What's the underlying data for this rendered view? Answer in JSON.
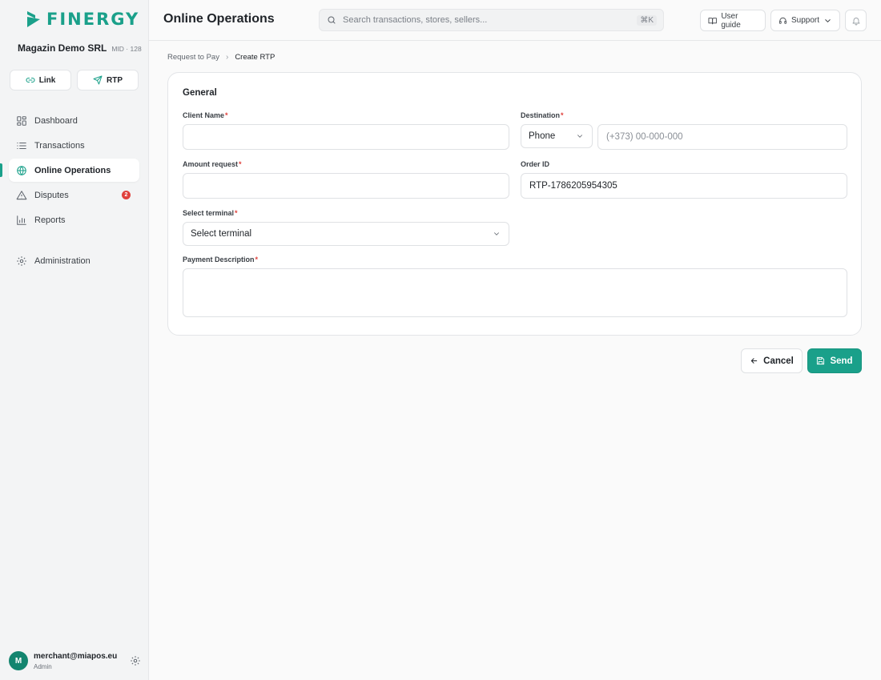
{
  "brand": {
    "name": "FINERGY",
    "accent_color": "#1aa08a"
  },
  "merchant": {
    "name": "Magazin Demo SRL",
    "mid": "MID · 128"
  },
  "quick_actions": [
    {
      "label": "Link",
      "icon": "link-icon"
    },
    {
      "label": "RTP",
      "icon": "send-icon"
    }
  ],
  "sidebar": {
    "items": [
      {
        "label": "Dashboard",
        "icon": "dashboard-icon"
      },
      {
        "label": "Transactions",
        "icon": "list-icon"
      },
      {
        "label": "Online Operations",
        "icon": "globe-icon",
        "active": true
      },
      {
        "label": "Disputes",
        "icon": "warning-icon",
        "badge": "2"
      },
      {
        "label": "Reports",
        "icon": "bar-chart-icon"
      },
      {
        "label": "Administration",
        "icon": "gear-icon"
      }
    ]
  },
  "user": {
    "initial": "M",
    "email": "merchant@miapos.eu",
    "role": "Admin"
  },
  "header": {
    "title": "Online Operations",
    "search_placeholder": "Search transactions, stores, sellers...",
    "search_shortcut": "⌘K",
    "user_guide_label": "User guide",
    "support_label": "Support"
  },
  "breadcrumb": {
    "parent": "Request to Pay",
    "separator": "›",
    "current": "Create RTP"
  },
  "form": {
    "section_title": "General",
    "required_mark": "*",
    "client_name": {
      "label": "Client Name",
      "value": ""
    },
    "destination": {
      "label": "Destination",
      "type_value": "Phone",
      "placeholder": "(+373) 00-000-000"
    },
    "amount": {
      "label": "Amount request",
      "value": ""
    },
    "order_id": {
      "label": "Order ID",
      "value": "RTP-1786205954305"
    },
    "terminal": {
      "label": "Select terminal",
      "value": "Select terminal"
    },
    "description": {
      "label": "Payment Description",
      "value": ""
    }
  },
  "buttons": {
    "cancel": "Cancel",
    "send": "Send"
  }
}
